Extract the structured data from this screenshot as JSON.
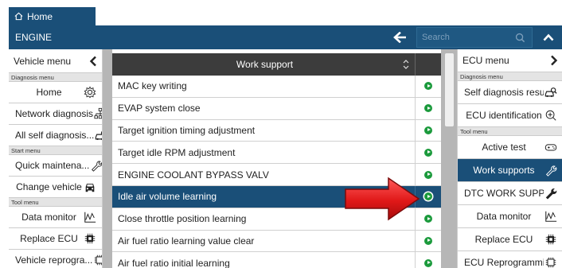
{
  "header": {
    "home_label": "Home",
    "engine_label": "ENGINE",
    "search_placeholder": "Search"
  },
  "left_panel": {
    "title": "Vehicle menu",
    "sections": [
      {
        "label": "Diagnosis menu"
      },
      {
        "label": "Start menu"
      },
      {
        "label": "Tool menu"
      }
    ],
    "items": [
      {
        "label": "Home",
        "icon": "gear-icon"
      },
      {
        "label": "Network diagnosis",
        "icon": "network-icon"
      },
      {
        "label": "All self diagnosis...",
        "icon": "car-search-icon"
      },
      {
        "label": "Quick maintena...",
        "icon": "wrench-icon"
      },
      {
        "label": "Change vehicle",
        "icon": "car-swap-icon"
      },
      {
        "label": "Data monitor",
        "icon": "monitor-graph-icon"
      },
      {
        "label": "Replace ECU",
        "icon": "chip-icon"
      },
      {
        "label": "Vehicle reprogra...",
        "icon": "chip-outline-icon"
      }
    ]
  },
  "table": {
    "title": "Work support",
    "rows": [
      {
        "label": "MAC key writing",
        "selected": false
      },
      {
        "label": "EVAP system close",
        "selected": false
      },
      {
        "label": "Target ignition timing adjustment",
        "selected": false
      },
      {
        "label": "Target idle RPM adjustment",
        "selected": false
      },
      {
        "label": "ENGINE COOLANT BYPASS VALV",
        "selected": false
      },
      {
        "label": "Idle air volume learning",
        "selected": true
      },
      {
        "label": "Close throttle position learning",
        "selected": false
      },
      {
        "label": "Air fuel ratio learning value clear",
        "selected": false
      },
      {
        "label": "Air fuel ratio initial learning",
        "selected": false
      }
    ],
    "accent": "#1b9a3c",
    "selected_color": "#1a4f78"
  },
  "right_panel": {
    "title": "ECU menu",
    "sections": [
      {
        "label": "Diagnosis menu"
      },
      {
        "label": "Tool menu"
      }
    ],
    "items": [
      {
        "label": "Self diagnosis result",
        "icon": "car-search-icon"
      },
      {
        "label": "ECU identification",
        "icon": "zoom-in-icon"
      },
      {
        "label": "Active test",
        "icon": "gamepad-icon"
      },
      {
        "label": "Work supports",
        "icon": "wrench-icon",
        "active": true
      },
      {
        "label": "DTC WORK SUPP...",
        "icon": "wrench-solid-icon"
      },
      {
        "label": "Data monitor",
        "icon": "monitor-graph-icon"
      },
      {
        "label": "Replace ECU",
        "icon": "chip-icon"
      },
      {
        "label": "ECU Reprogramming",
        "icon": "chip-outline-icon"
      }
    ]
  },
  "annotation": {
    "arrow_color": "#e02020"
  }
}
